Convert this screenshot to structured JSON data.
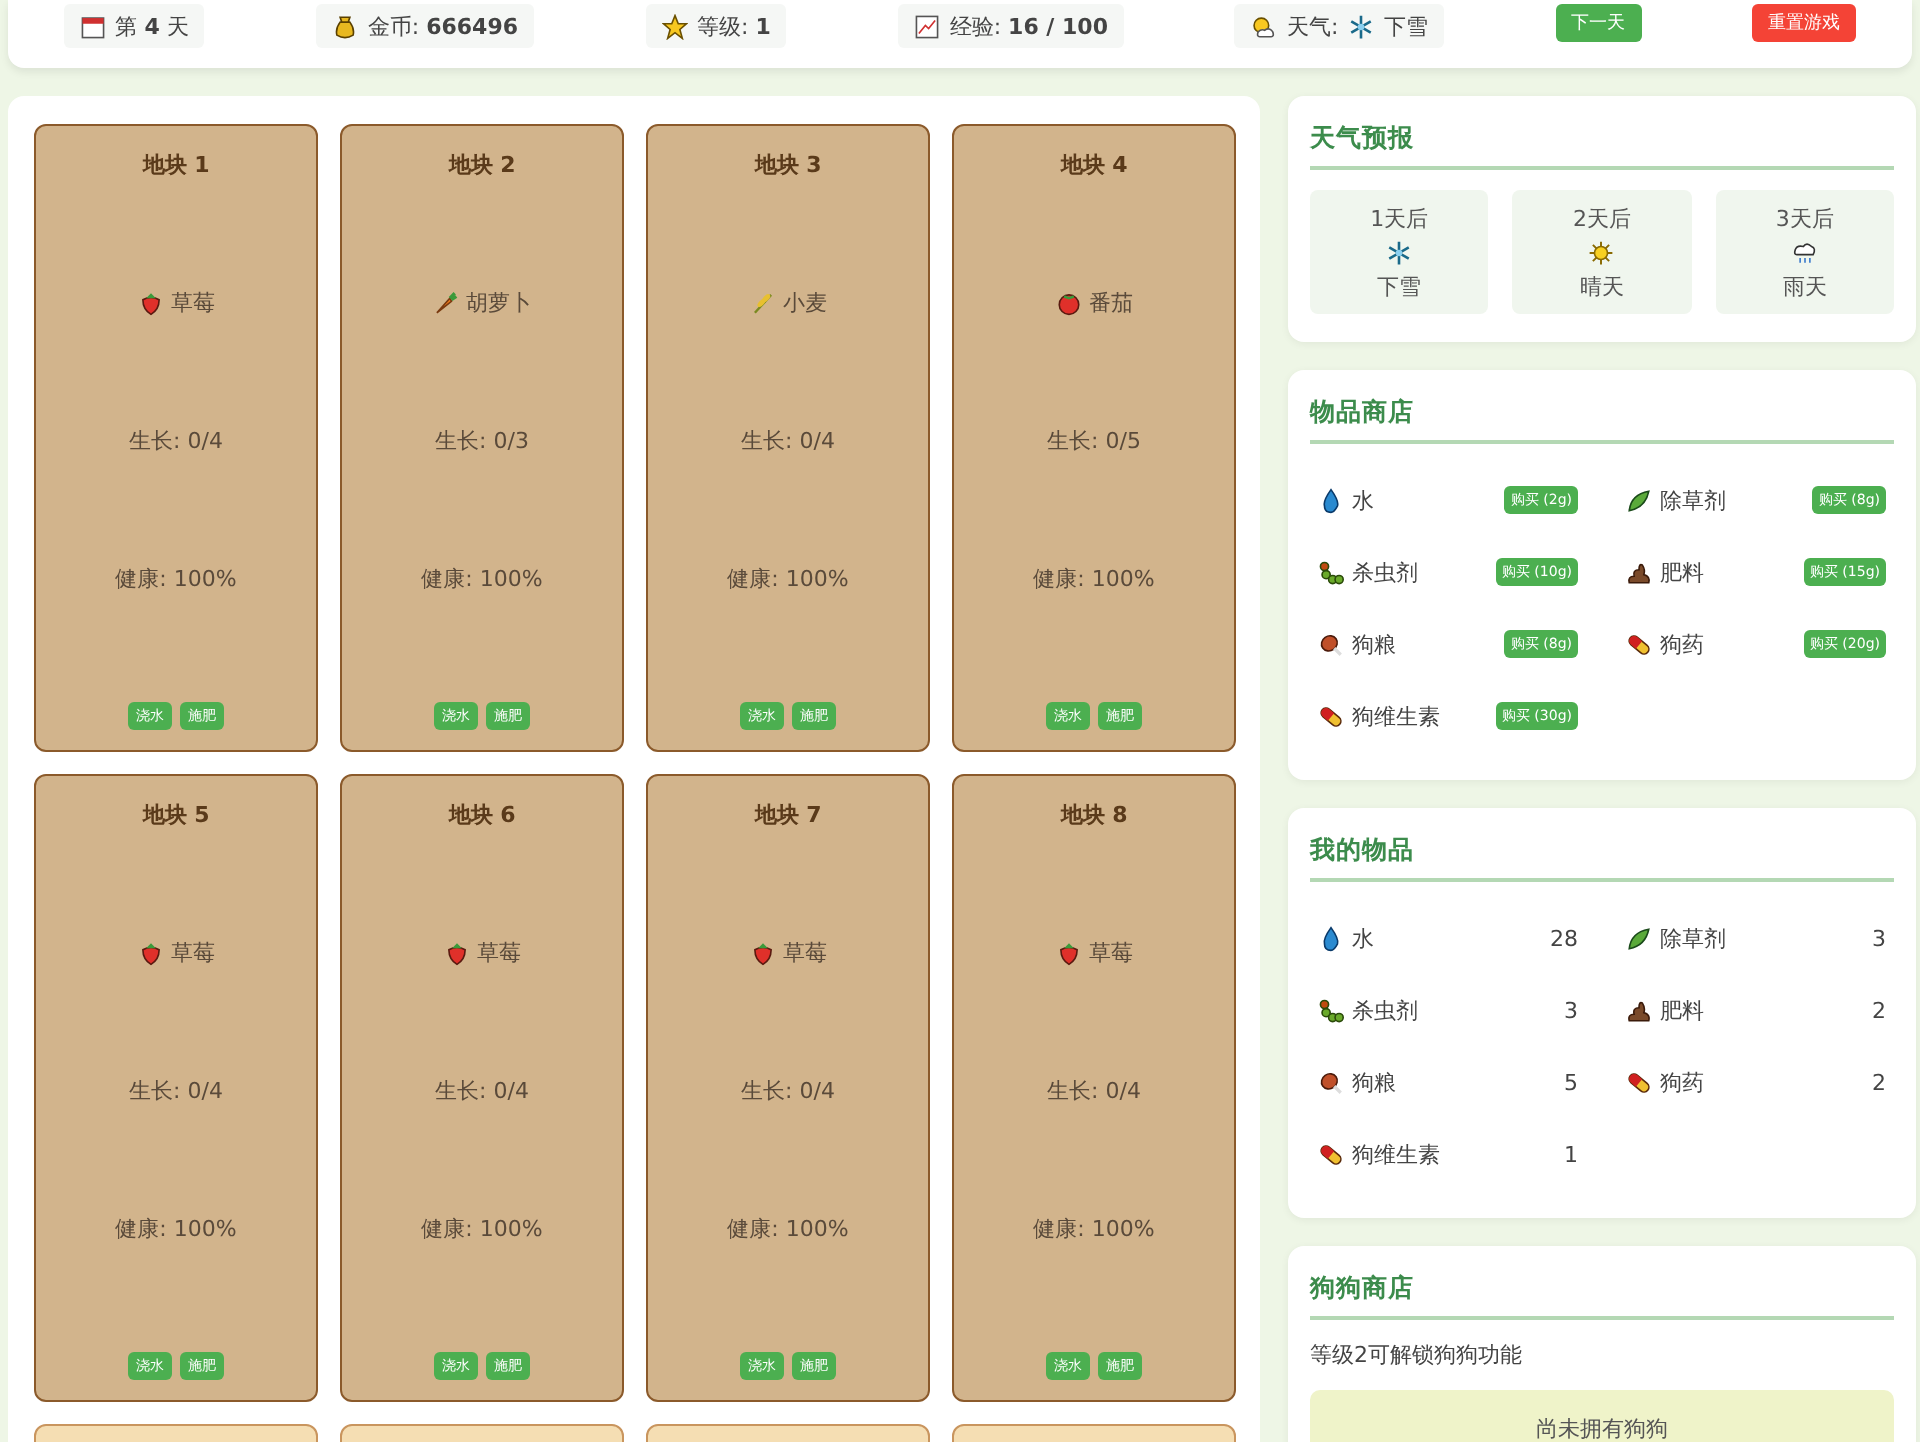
{
  "status_bar": {
    "day": "第 **4** 天",
    "coins": "金币: **666496**",
    "level": "等级: **1**",
    "exp": "经验: **16 / 100**",
    "weather_label": "天气:",
    "weather": {
      "kind": "snow",
      "text": "下雪"
    },
    "next_day_button": "下一天",
    "reset_button": "重置游戏"
  },
  "plots": [
    {
      "title": "地块 1",
      "planted": true,
      "kind": "strawberry",
      "crop": "草莓",
      "growth": "生长: 0/4",
      "health": "健康: 100%",
      "actions": [
        "浇水",
        "施肥"
      ]
    },
    {
      "title": "地块 2",
      "planted": true,
      "kind": "carrot",
      "crop": "胡萝卜",
      "growth": "生长: 0/3",
      "health": "健康: 100%",
      "actions": [
        "浇水",
        "施肥"
      ]
    },
    {
      "title": "地块 3",
      "planted": true,
      "kind": "wheat",
      "crop": "小麦",
      "growth": "生长: 0/4",
      "health": "健康: 100%",
      "actions": [
        "浇水",
        "施肥"
      ]
    },
    {
      "title": "地块 4",
      "planted": true,
      "kind": "tomato",
      "crop": "番茄",
      "growth": "生长: 0/5",
      "health": "健康: 100%",
      "actions": [
        "浇水",
        "施肥"
      ]
    },
    {
      "title": "地块 5",
      "planted": true,
      "kind": "strawberry",
      "crop": "草莓",
      "growth": "生长: 0/4",
      "health": "健康: 100%",
      "actions": [
        "浇水",
        "施肥"
      ]
    },
    {
      "title": "地块 6",
      "planted": true,
      "kind": "strawberry",
      "crop": "草莓",
      "growth": "生长: 0/4",
      "health": "健康: 100%",
      "actions": [
        "浇水",
        "施肥"
      ]
    },
    {
      "title": "地块 7",
      "planted": true,
      "kind": "strawberry",
      "crop": "草莓",
      "growth": "生长: 0/4",
      "health": "健康: 100%",
      "actions": [
        "浇水",
        "施肥"
      ]
    },
    {
      "title": "地块 8",
      "planted": true,
      "kind": "strawberry",
      "crop": "草莓",
      "growth": "生长: 0/4",
      "health": "健康: 100%",
      "actions": [
        "浇水",
        "施肥"
      ]
    },
    {
      "planted": false
    },
    {
      "planted": false
    },
    {
      "planted": false
    },
    {
      "planted": false
    }
  ],
  "weather_forecast": {
    "title": "天气预报",
    "days": [
      {
        "day": "1天后",
        "kind": "snow",
        "weather": "下雪"
      },
      {
        "day": "2天后",
        "kind": "sun",
        "weather": "晴天"
      },
      {
        "day": "3天后",
        "kind": "rain",
        "weather": "雨天"
      }
    ]
  },
  "item_shop": {
    "title": "物品商店",
    "items": [
      {
        "kind": "water",
        "name": "水",
        "buy": "购买 (2g)"
      },
      {
        "kind": "herbicide",
        "name": "除草剂",
        "buy": "购买 (8g)"
      },
      {
        "kind": "pesticide",
        "name": "杀虫剂",
        "buy": "购买 (10g)"
      },
      {
        "kind": "fertilizer",
        "name": "肥料",
        "buy": "购买 (15g)"
      },
      {
        "kind": "dogfood",
        "name": "狗粮",
        "buy": "购买 (8g)"
      },
      {
        "kind": "medicine",
        "name": "狗药",
        "buy": "购买 (20g)"
      },
      {
        "kind": "vitamin",
        "name": "狗维生素",
        "buy": "购买 (30g)"
      }
    ]
  },
  "inventory": {
    "title": "我的物品",
    "items": [
      {
        "kind": "water",
        "name": "水",
        "count": "28"
      },
      {
        "kind": "herbicide",
        "name": "除草剂",
        "count": "3"
      },
      {
        "kind": "pesticide",
        "name": "杀虫剂",
        "count": "3"
      },
      {
        "kind": "fertilizer",
        "name": "肥料",
        "count": "2"
      },
      {
        "kind": "dogfood",
        "name": "狗粮",
        "count": "5"
      },
      {
        "kind": "medicine",
        "name": "狗药",
        "count": "2"
      },
      {
        "kind": "vitamin",
        "name": "狗维生素",
        "count": "1"
      }
    ]
  },
  "dog_shop": {
    "title": "狗狗商店",
    "note": "等级2可解锁狗狗功能",
    "empty": "尚未拥有狗狗"
  }
}
